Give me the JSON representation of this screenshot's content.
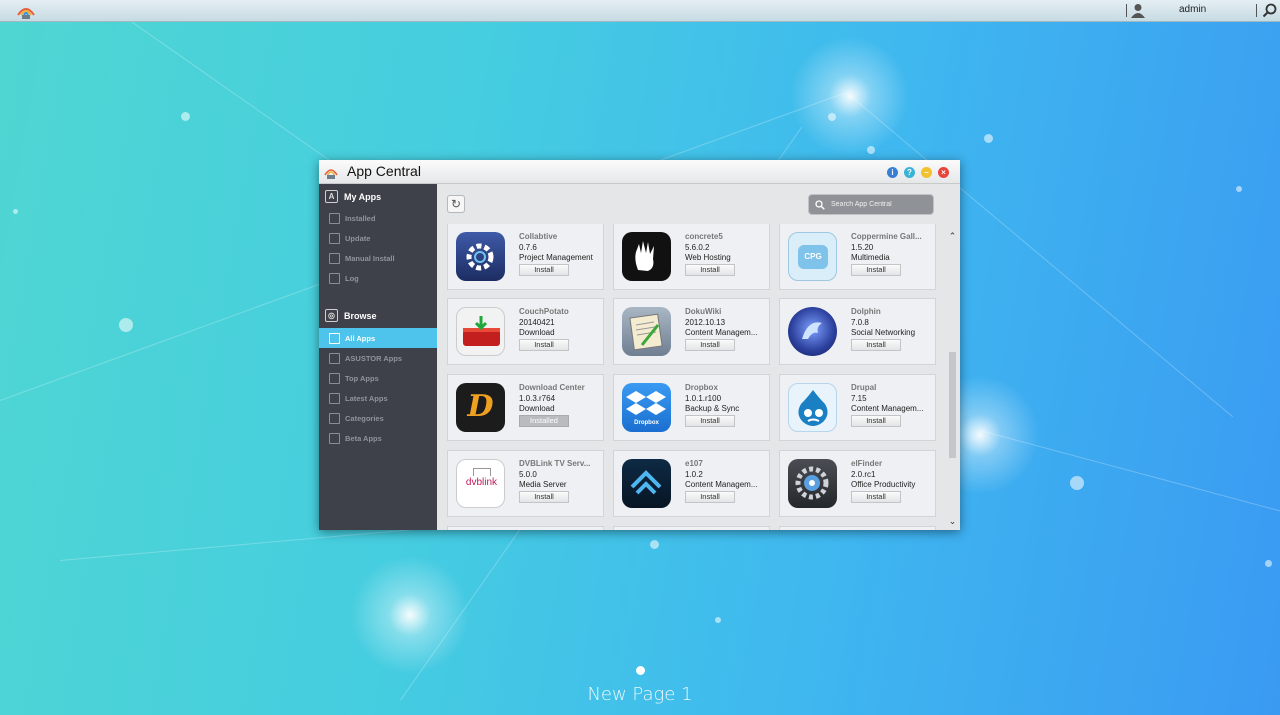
{
  "topbar": {
    "username": "admin",
    "icons": [
      "asustor-logo-icon",
      "user-icon",
      "search-icon"
    ]
  },
  "window": {
    "title": "App Central",
    "controls": [
      "info-icon",
      "help-icon",
      "minimize-icon",
      "close-icon"
    ]
  },
  "sidebar": {
    "my_apps": {
      "heading": "My Apps",
      "items": [
        {
          "label": "Installed",
          "icon": "installed-icon"
        },
        {
          "label": "Update",
          "icon": "update-icon"
        },
        {
          "label": "Manual Install",
          "icon": "folder-icon"
        },
        {
          "label": "Log",
          "icon": "log-icon"
        }
      ]
    },
    "browse": {
      "heading": "Browse",
      "items": [
        {
          "label": "All Apps",
          "icon": "grid-icon",
          "active": true
        },
        {
          "label": "ASUSTOR Apps",
          "icon": "asustor-icon"
        },
        {
          "label": "Top Apps",
          "icon": "star-icon"
        },
        {
          "label": "Latest Apps",
          "icon": "new-icon"
        },
        {
          "label": "Categories",
          "icon": "list-icon"
        },
        {
          "label": "Beta Apps",
          "icon": "beta-icon"
        }
      ]
    }
  },
  "search": {
    "placeholder": "Search App Central"
  },
  "apps": [
    {
      "name": "Collabtive",
      "version": "0.7.6",
      "category": "Project Management",
      "button": "Install",
      "icon_color": "#2a3f7a"
    },
    {
      "name": "concrete5",
      "version": "5.6.0.2",
      "category": "Web Hosting",
      "button": "Install",
      "icon_color": "#111111"
    },
    {
      "name": "Coppermine Gall...",
      "version": "1.5.20",
      "category": "Multimedia",
      "button": "Install",
      "icon_color": "#9fd3ef"
    },
    {
      "name": "CouchPotato",
      "version": "20140421",
      "category": "Download",
      "button": "Install",
      "icon_color": "#c41f1f"
    },
    {
      "name": "DokuWiki",
      "version": "2012.10.13",
      "category": "Content Managem...",
      "button": "Install",
      "icon_color": "#8a9bb0"
    },
    {
      "name": "Dolphin",
      "version": "7.0.8",
      "category": "Social Networking",
      "button": "Install",
      "icon_color": "#2b3f9c"
    },
    {
      "name": "Download Center",
      "version": "1.0.3.r764",
      "category": "Download",
      "button": "Installed",
      "icon_color": "#1c1c1c"
    },
    {
      "name": "Dropbox",
      "version": "1.0.1.r100",
      "category": "Backup & Sync",
      "button": "Install",
      "icon_color": "#1a7fd6"
    },
    {
      "name": "Drupal",
      "version": "7.15",
      "category": "Content Managem...",
      "button": "Install",
      "icon_color": "#d9ecf8"
    },
    {
      "name": "DVBLink TV Serv...",
      "version": "5.0.0",
      "category": "Media Server",
      "button": "Install",
      "icon_color": "#ffffff"
    },
    {
      "name": "e107",
      "version": "1.0.2",
      "category": "Content Managem...",
      "button": "Install",
      "icon_color": "#0e2a45"
    },
    {
      "name": "elFinder",
      "version": "2.0.rc1",
      "category": "Office Productivity",
      "button": "Install",
      "icon_color": "#2f3236"
    }
  ],
  "icon_text": {
    "coppermine": "CPG",
    "dropbox": "Dropbox",
    "dvblink": "dvblink",
    "download_center": "D"
  },
  "scroll": {
    "up": "⌃",
    "down": "⌄"
  },
  "desktop": {
    "page_label": "New Page 1"
  }
}
